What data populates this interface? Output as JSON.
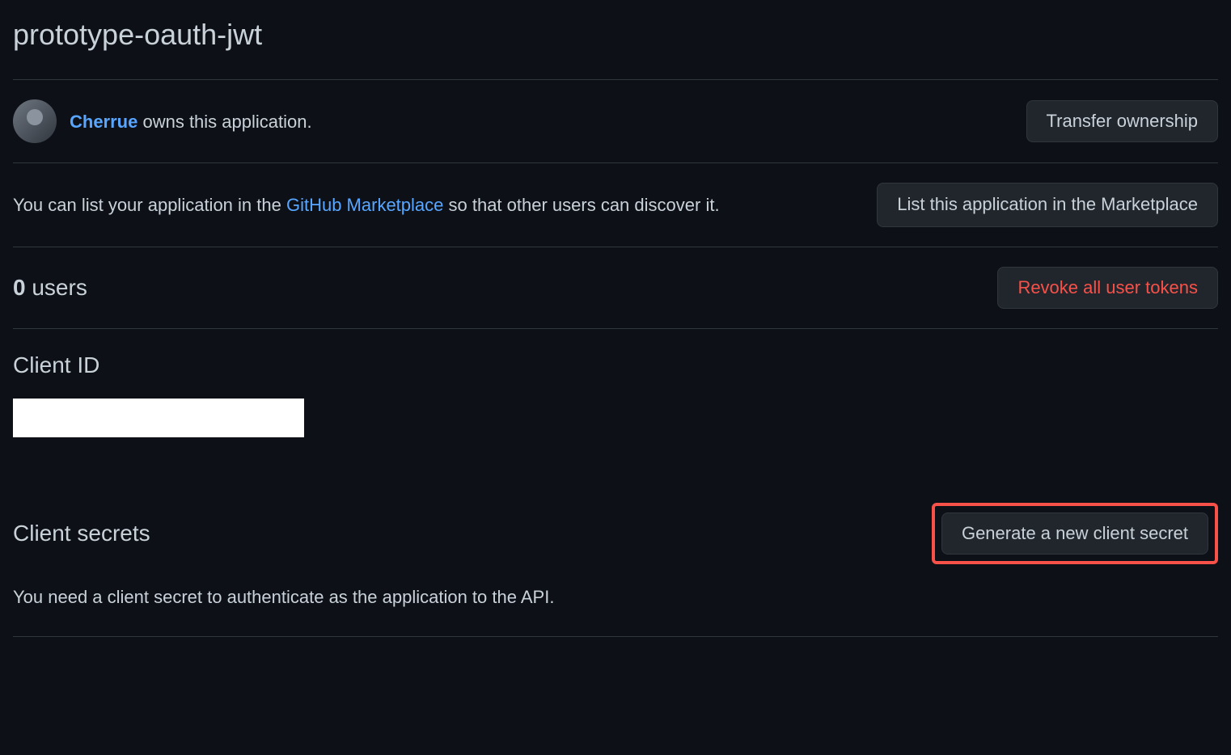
{
  "page": {
    "title": "prototype-oauth-jwt"
  },
  "owner": {
    "name": "Cherrue",
    "suffix_text": " owns this application."
  },
  "buttons": {
    "transfer_ownership": "Transfer ownership",
    "list_marketplace": "List this application in the Marketplace",
    "revoke_tokens": "Revoke all user tokens",
    "generate_secret": "Generate a new client secret"
  },
  "marketplace": {
    "text_prefix": "You can list your application in the ",
    "link_text": "GitHub Marketplace",
    "text_suffix": " so that other users can discover it."
  },
  "users": {
    "count": "0",
    "label": " users"
  },
  "client_id": {
    "heading": "Client ID"
  },
  "client_secrets": {
    "heading": "Client secrets",
    "description": "You need a client secret to authenticate as the application to the API."
  }
}
